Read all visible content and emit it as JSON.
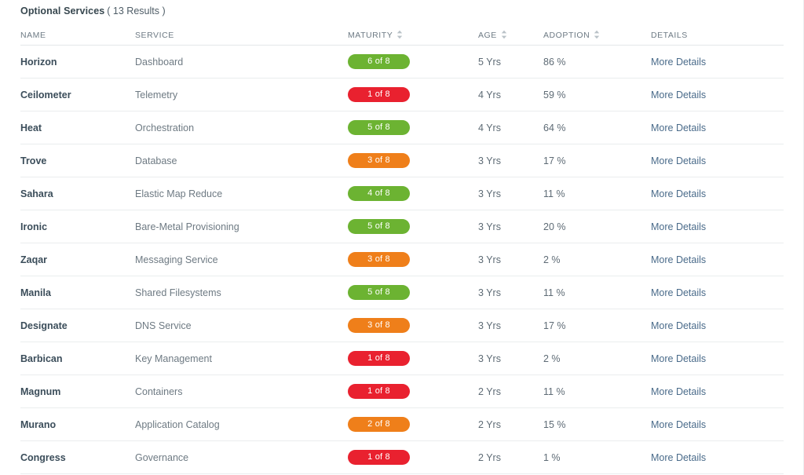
{
  "panel": {
    "title": "Optional Services",
    "results": "( 13 Results )"
  },
  "table": {
    "columns": [
      {
        "key": "name",
        "label": "NAME",
        "sortable": false,
        "icon": ""
      },
      {
        "key": "service",
        "label": "SERVICE",
        "sortable": false,
        "icon": ""
      },
      {
        "key": "maturity",
        "label": "MATURITY",
        "sortable": true,
        "icon": "sort-updown-icon"
      },
      {
        "key": "age",
        "label": "AGE",
        "sortable": true,
        "icon": "sort-updown-icon"
      },
      {
        "key": "adoption",
        "label": "ADOPTION",
        "sortable": true,
        "icon": "sort-updown-icon"
      },
      {
        "key": "details",
        "label": "DETAILS",
        "sortable": false,
        "icon": ""
      }
    ],
    "details_label": "More Details",
    "rows": [
      {
        "name": "Horizon",
        "service": "Dashboard",
        "maturity": "6 of 8",
        "maturity_color": "green",
        "age": "5 Yrs",
        "adoption": "86 %",
        "details": "More Details"
      },
      {
        "name": "Ceilometer",
        "service": "Telemetry",
        "maturity": "1 of 8",
        "maturity_color": "red",
        "age": "4 Yrs",
        "adoption": "59 %",
        "details": "More Details"
      },
      {
        "name": "Heat",
        "service": "Orchestration",
        "maturity": "5 of 8",
        "maturity_color": "green",
        "age": "4 Yrs",
        "adoption": "64 %",
        "details": "More Details"
      },
      {
        "name": "Trove",
        "service": "Database",
        "maturity": "3 of 8",
        "maturity_color": "orange",
        "age": "3 Yrs",
        "adoption": "17 %",
        "details": "More Details"
      },
      {
        "name": "Sahara",
        "service": "Elastic Map Reduce",
        "maturity": "4 of 8",
        "maturity_color": "green",
        "age": "3 Yrs",
        "adoption": "11 %",
        "details": "More Details"
      },
      {
        "name": "Ironic",
        "service": "Bare-Metal Provisioning",
        "maturity": "5 of 8",
        "maturity_color": "green",
        "age": "3 Yrs",
        "adoption": "20 %",
        "details": "More Details"
      },
      {
        "name": "Zaqar",
        "service": "Messaging Service",
        "maturity": "3 of 8",
        "maturity_color": "orange",
        "age": "3 Yrs",
        "adoption": "2 %",
        "details": "More Details"
      },
      {
        "name": "Manila",
        "service": "Shared Filesystems",
        "maturity": "5 of 8",
        "maturity_color": "green",
        "age": "3 Yrs",
        "adoption": "11 %",
        "details": "More Details"
      },
      {
        "name": "Designate",
        "service": "DNS Service",
        "maturity": "3 of 8",
        "maturity_color": "orange",
        "age": "3 Yrs",
        "adoption": "17 %",
        "details": "More Details"
      },
      {
        "name": "Barbican",
        "service": "Key Management",
        "maturity": "1 of 8",
        "maturity_color": "red",
        "age": "3 Yrs",
        "adoption": "2 %",
        "details": "More Details"
      },
      {
        "name": "Magnum",
        "service": "Containers",
        "maturity": "1 of 8",
        "maturity_color": "red",
        "age": "2 Yrs",
        "adoption": "11 %",
        "details": "More Details"
      },
      {
        "name": "Murano",
        "service": "Application Catalog",
        "maturity": "2 of 8",
        "maturity_color": "orange",
        "age": "2 Yrs",
        "adoption": "15 %",
        "details": "More Details"
      },
      {
        "name": "Congress",
        "service": "Governance",
        "maturity": "1 of 8",
        "maturity_color": "red",
        "age": "2 Yrs",
        "adoption": "1 %",
        "details": "More Details"
      }
    ]
  },
  "colors": {
    "maturity_green": "#6cb332",
    "maturity_orange": "#ef7f1a",
    "maturity_red": "#e9212f",
    "link": "#4a6b8a",
    "name_text": "#3b4d5a",
    "muted_text": "#6b7780",
    "row_border": "#eaedee"
  }
}
